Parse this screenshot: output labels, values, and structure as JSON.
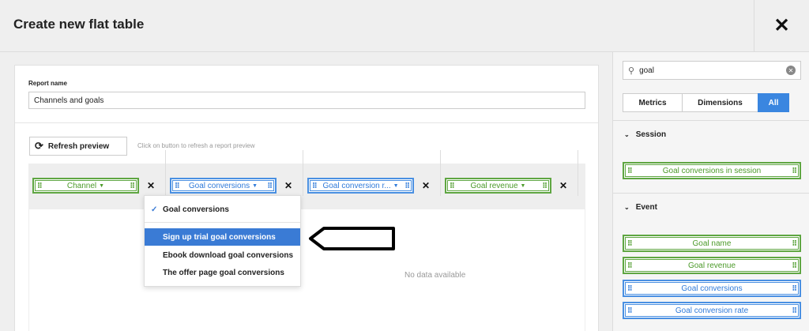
{
  "header": {
    "title": "Create new flat table",
    "close_glyph": "✕"
  },
  "report": {
    "label": "Report name",
    "value": "Channels and goals"
  },
  "preview": {
    "refresh_label": "Refresh preview",
    "hint": "Click on button to refresh a report preview"
  },
  "columns": [
    {
      "label": "Channel",
      "type": "dimension",
      "color": "#5fa642"
    },
    {
      "label": "Goal conversions",
      "type": "metric",
      "color": "#4a90e2"
    },
    {
      "label": "Goal conversion r...",
      "type": "metric",
      "color": "#4a90e2"
    },
    {
      "label": "Goal revenue",
      "type": "dimension",
      "color": "#5fa642"
    }
  ],
  "dropdown": {
    "items": [
      {
        "label": "Goal conversions",
        "checked": true
      },
      {
        "label": "Sign up trial goal conversions",
        "highlighted": true
      },
      {
        "label": "Ebook download goal conversions"
      },
      {
        "label": "The offer page goal conversions"
      }
    ]
  },
  "table": {
    "empty_text": "No data available"
  },
  "sidebar": {
    "search": {
      "value": "goal",
      "placeholder": "Search"
    },
    "tabs": [
      {
        "label": "Metrics",
        "active": false
      },
      {
        "label": "Dimensions",
        "active": false
      },
      {
        "label": "All",
        "active": true
      }
    ],
    "groups": [
      {
        "title": "Session",
        "items": [
          {
            "label": "Goal conversions in session",
            "kind": "dimension"
          }
        ]
      },
      {
        "title": "Event",
        "items": [
          {
            "label": "Goal name",
            "kind": "dimension"
          },
          {
            "label": "Goal revenue",
            "kind": "dimension"
          },
          {
            "label": "Goal conversions",
            "kind": "metric"
          },
          {
            "label": "Goal conversion rate",
            "kind": "metric"
          }
        ]
      }
    ]
  },
  "colors": {
    "dimension": "#5fa642",
    "metric": "#4a90e2",
    "accent": "#3a7bd5"
  }
}
